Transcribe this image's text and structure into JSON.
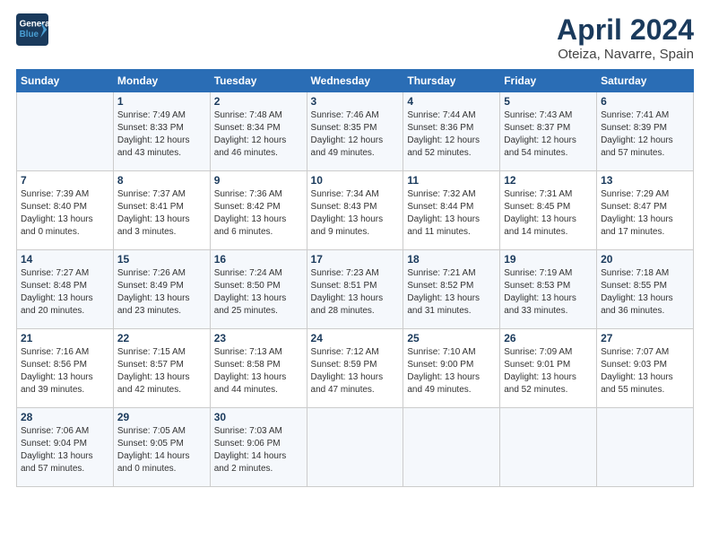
{
  "logo": {
    "line1": "General",
    "line2": "Blue"
  },
  "title": "April 2024",
  "location": "Oteiza, Navarre, Spain",
  "days_of_week": [
    "Sunday",
    "Monday",
    "Tuesday",
    "Wednesday",
    "Thursday",
    "Friday",
    "Saturday"
  ],
  "weeks": [
    [
      {
        "day": "",
        "info": ""
      },
      {
        "day": "1",
        "info": "Sunrise: 7:49 AM\nSunset: 8:33 PM\nDaylight: 12 hours\nand 43 minutes."
      },
      {
        "day": "2",
        "info": "Sunrise: 7:48 AM\nSunset: 8:34 PM\nDaylight: 12 hours\nand 46 minutes."
      },
      {
        "day": "3",
        "info": "Sunrise: 7:46 AM\nSunset: 8:35 PM\nDaylight: 12 hours\nand 49 minutes."
      },
      {
        "day": "4",
        "info": "Sunrise: 7:44 AM\nSunset: 8:36 PM\nDaylight: 12 hours\nand 52 minutes."
      },
      {
        "day": "5",
        "info": "Sunrise: 7:43 AM\nSunset: 8:37 PM\nDaylight: 12 hours\nand 54 minutes."
      },
      {
        "day": "6",
        "info": "Sunrise: 7:41 AM\nSunset: 8:39 PM\nDaylight: 12 hours\nand 57 minutes."
      }
    ],
    [
      {
        "day": "7",
        "info": "Sunrise: 7:39 AM\nSunset: 8:40 PM\nDaylight: 13 hours\nand 0 minutes."
      },
      {
        "day": "8",
        "info": "Sunrise: 7:37 AM\nSunset: 8:41 PM\nDaylight: 13 hours\nand 3 minutes."
      },
      {
        "day": "9",
        "info": "Sunrise: 7:36 AM\nSunset: 8:42 PM\nDaylight: 13 hours\nand 6 minutes."
      },
      {
        "day": "10",
        "info": "Sunrise: 7:34 AM\nSunset: 8:43 PM\nDaylight: 13 hours\nand 9 minutes."
      },
      {
        "day": "11",
        "info": "Sunrise: 7:32 AM\nSunset: 8:44 PM\nDaylight: 13 hours\nand 11 minutes."
      },
      {
        "day": "12",
        "info": "Sunrise: 7:31 AM\nSunset: 8:45 PM\nDaylight: 13 hours\nand 14 minutes."
      },
      {
        "day": "13",
        "info": "Sunrise: 7:29 AM\nSunset: 8:47 PM\nDaylight: 13 hours\nand 17 minutes."
      }
    ],
    [
      {
        "day": "14",
        "info": "Sunrise: 7:27 AM\nSunset: 8:48 PM\nDaylight: 13 hours\nand 20 minutes."
      },
      {
        "day": "15",
        "info": "Sunrise: 7:26 AM\nSunset: 8:49 PM\nDaylight: 13 hours\nand 23 minutes."
      },
      {
        "day": "16",
        "info": "Sunrise: 7:24 AM\nSunset: 8:50 PM\nDaylight: 13 hours\nand 25 minutes."
      },
      {
        "day": "17",
        "info": "Sunrise: 7:23 AM\nSunset: 8:51 PM\nDaylight: 13 hours\nand 28 minutes."
      },
      {
        "day": "18",
        "info": "Sunrise: 7:21 AM\nSunset: 8:52 PM\nDaylight: 13 hours\nand 31 minutes."
      },
      {
        "day": "19",
        "info": "Sunrise: 7:19 AM\nSunset: 8:53 PM\nDaylight: 13 hours\nand 33 minutes."
      },
      {
        "day": "20",
        "info": "Sunrise: 7:18 AM\nSunset: 8:55 PM\nDaylight: 13 hours\nand 36 minutes."
      }
    ],
    [
      {
        "day": "21",
        "info": "Sunrise: 7:16 AM\nSunset: 8:56 PM\nDaylight: 13 hours\nand 39 minutes."
      },
      {
        "day": "22",
        "info": "Sunrise: 7:15 AM\nSunset: 8:57 PM\nDaylight: 13 hours\nand 42 minutes."
      },
      {
        "day": "23",
        "info": "Sunrise: 7:13 AM\nSunset: 8:58 PM\nDaylight: 13 hours\nand 44 minutes."
      },
      {
        "day": "24",
        "info": "Sunrise: 7:12 AM\nSunset: 8:59 PM\nDaylight: 13 hours\nand 47 minutes."
      },
      {
        "day": "25",
        "info": "Sunrise: 7:10 AM\nSunset: 9:00 PM\nDaylight: 13 hours\nand 49 minutes."
      },
      {
        "day": "26",
        "info": "Sunrise: 7:09 AM\nSunset: 9:01 PM\nDaylight: 13 hours\nand 52 minutes."
      },
      {
        "day": "27",
        "info": "Sunrise: 7:07 AM\nSunset: 9:03 PM\nDaylight: 13 hours\nand 55 minutes."
      }
    ],
    [
      {
        "day": "28",
        "info": "Sunrise: 7:06 AM\nSunset: 9:04 PM\nDaylight: 13 hours\nand 57 minutes."
      },
      {
        "day": "29",
        "info": "Sunrise: 7:05 AM\nSunset: 9:05 PM\nDaylight: 14 hours\nand 0 minutes."
      },
      {
        "day": "30",
        "info": "Sunrise: 7:03 AM\nSunset: 9:06 PM\nDaylight: 14 hours\nand 2 minutes."
      },
      {
        "day": "",
        "info": ""
      },
      {
        "day": "",
        "info": ""
      },
      {
        "day": "",
        "info": ""
      },
      {
        "day": "",
        "info": ""
      }
    ]
  ]
}
